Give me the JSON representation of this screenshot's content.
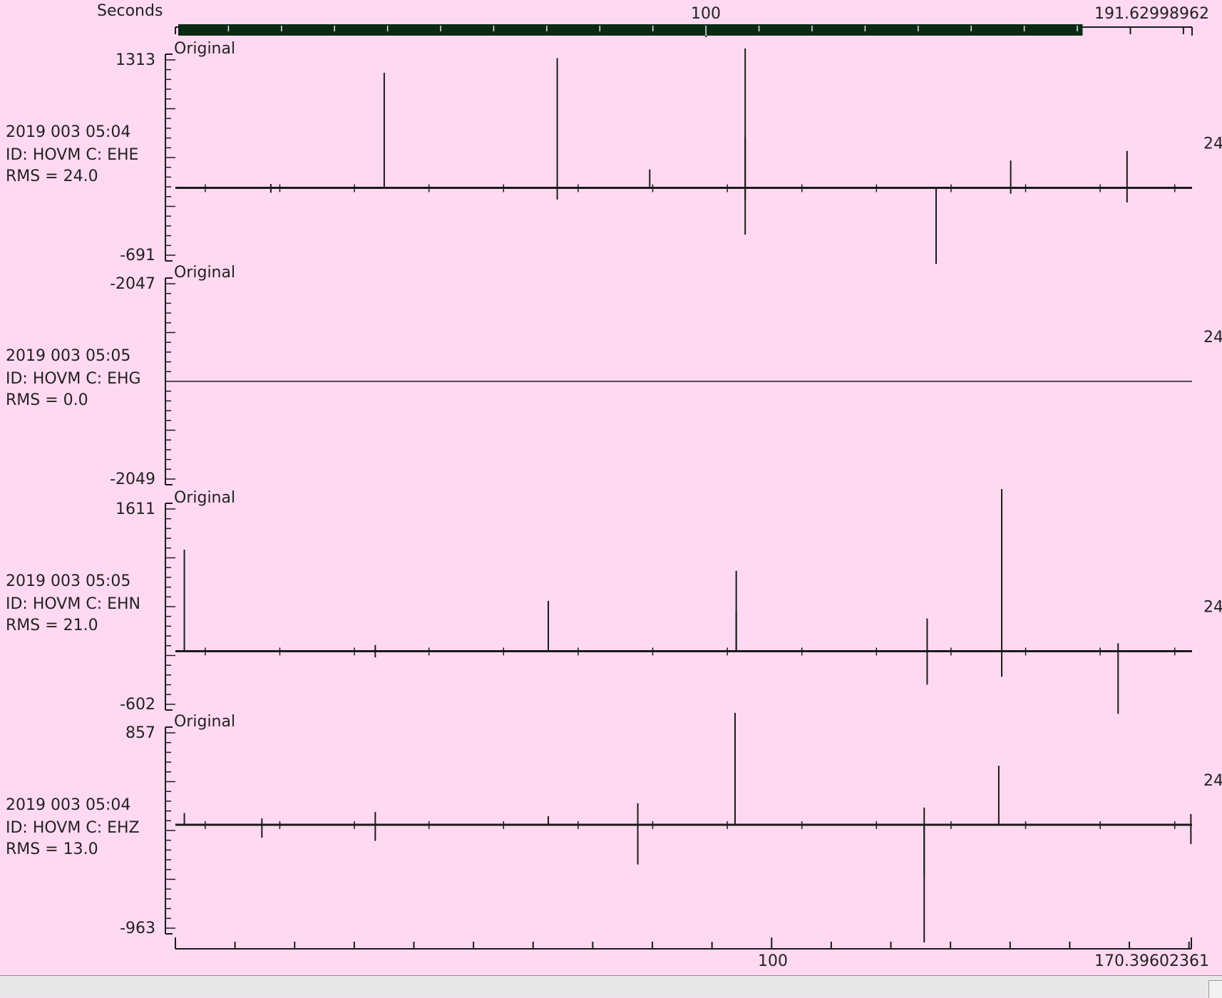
{
  "top_axis": {
    "unit_label": "Seconds",
    "tick_label": "100",
    "end_label": "191.62998962",
    "range": [
      0,
      191.62998962
    ],
    "scrollbar_window": [
      0,
      171
    ]
  },
  "bottom_axis": {
    "tick_label": "100",
    "end_label": "170.39602361",
    "range": [
      0,
      170.39602361
    ]
  },
  "colors": {
    "background": "#ffd9f1",
    "trace": "#1a1a1a",
    "scrollbar": "#0b2a14",
    "status_bar": "#e8e8e8"
  },
  "chart_data": [
    {
      "type": "line",
      "panel_label": "Original",
      "info_time": "2019 003 05:04",
      "info_id": "ID: HOVM C: EHE",
      "info_rms": "RMS = 24.0",
      "y_max_label": "1313",
      "y_min_label": "-691",
      "ylim": [
        -691,
        1313
      ],
      "side_label": "24",
      "baseline": 0,
      "spikes": [
        {
          "x": 16.0,
          "y1": -50,
          "y2": 40
        },
        {
          "x": 35.0,
          "y1": 0,
          "y2": 1180
        },
        {
          "x": 64.0,
          "y1": -120,
          "y2": 1330
        },
        {
          "x": 79.5,
          "y1": 0,
          "y2": 190
        },
        {
          "x": 95.5,
          "y1": -480,
          "y2": 1430
        },
        {
          "x": 95.5,
          "y1": -120,
          "y2": 520
        },
        {
          "x": 127.5,
          "y1": -780,
          "y2": 0
        },
        {
          "x": 140.0,
          "y1": -60,
          "y2": 280
        },
        {
          "x": 159.5,
          "y1": -150,
          "y2": 380
        }
      ]
    },
    {
      "type": "line",
      "panel_label": "Original",
      "info_time": "2019 003 05:05",
      "info_id": "ID: HOVM C: EHG",
      "info_rms": "RMS = 0.0",
      "y_max_label": "-2047",
      "y_min_label": "-2049",
      "ylim": [
        -2049,
        -2047
      ],
      "side_label": "24",
      "baseline": -2048,
      "spikes": []
    },
    {
      "type": "line",
      "panel_label": "Original",
      "info_time": "2019 003 05:05",
      "info_id": "ID: HOVM C: EHN",
      "info_rms": "RMS = 21.0",
      "y_max_label": "1611",
      "y_min_label": "-602",
      "ylim": [
        -602,
        1611
      ],
      "side_label": "24",
      "baseline": 0,
      "spikes": [
        {
          "x": 1.5,
          "y1": 0,
          "y2": 1150
        },
        {
          "x": 33.5,
          "y1": -70,
          "y2": 70
        },
        {
          "x": 62.5,
          "y1": 0,
          "y2": 570
        },
        {
          "x": 94.0,
          "y1": 0,
          "y2": 910
        },
        {
          "x": 94.0,
          "y1": 0,
          "y2": 460
        },
        {
          "x": 126.0,
          "y1": -380,
          "y2": 370
        },
        {
          "x": 138.5,
          "y1": -290,
          "y2": 1870
        },
        {
          "x": 158.0,
          "y1": -710,
          "y2": 90
        }
      ]
    },
    {
      "type": "line",
      "panel_label": "Original",
      "info_time": "2019 003 05:04",
      "info_id": "ID: HOVM C: EHZ",
      "info_rms": "RMS = 13.0",
      "y_max_label": "857",
      "y_min_label": "-963",
      "ylim": [
        -963,
        857
      ],
      "side_label": "24",
      "baseline": 0,
      "spikes": [
        {
          "x": 1.5,
          "y1": 0,
          "y2": 110
        },
        {
          "x": 14.5,
          "y1": -120,
          "y2": 60
        },
        {
          "x": 33.5,
          "y1": -150,
          "y2": 120
        },
        {
          "x": 62.5,
          "y1": 0,
          "y2": 80
        },
        {
          "x": 77.5,
          "y1": -370,
          "y2": 200
        },
        {
          "x": 93.8,
          "y1": 0,
          "y2": 1140
        },
        {
          "x": 125.5,
          "y1": -1300,
          "y2": 160
        },
        {
          "x": 125.5,
          "y1": -480,
          "y2": 0
        },
        {
          "x": 138.0,
          "y1": 0,
          "y2": 550
        },
        {
          "x": 170.2,
          "y1": -180,
          "y2": 100
        }
      ]
    }
  ]
}
